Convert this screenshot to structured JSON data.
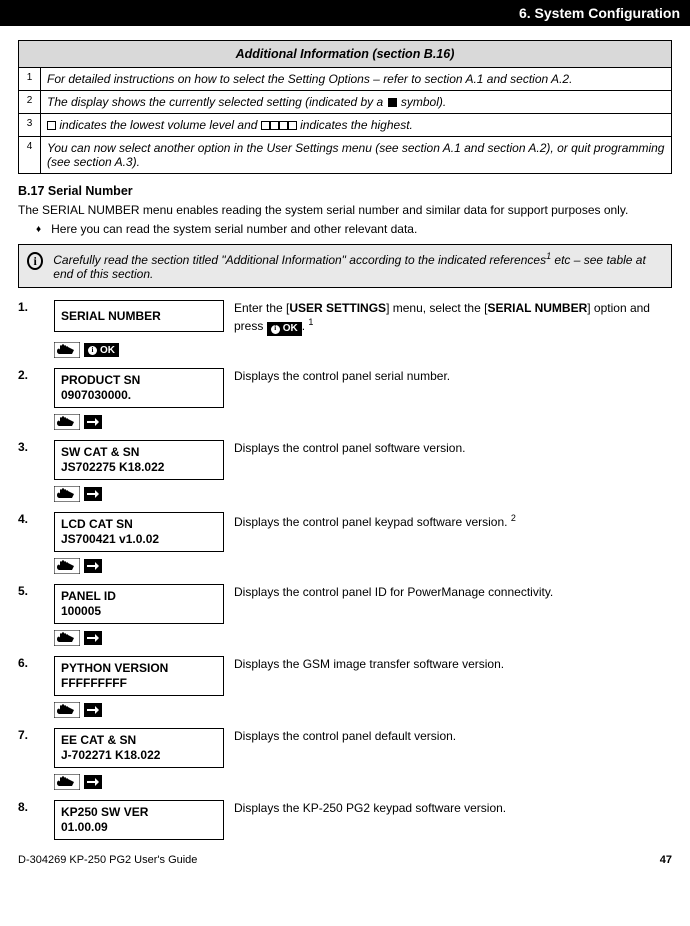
{
  "header": {
    "chapter": "6. System Configuration"
  },
  "ai_table": {
    "title": "Additional Information (section B.16)",
    "rows": [
      {
        "n": "1",
        "text": "For detailed instructions on how to select the Setting Options – refer to section A.1 and section A.2."
      },
      {
        "n": "2",
        "text_pre": "The display shows the currently selected setting (indicated by a ",
        "text_post": " symbol)."
      },
      {
        "n": "3",
        "text_pre_single": " indicates the lowest volume level and ",
        "text_post_single": " indicates the highest."
      },
      {
        "n": "4",
        "text": "You can now select another option in the User Settings menu (see section A.1 and section A.2), or quit programming (see section A.3)."
      }
    ]
  },
  "section": {
    "heading": "B.17 Serial Number",
    "intro": "The SERIAL NUMBER menu enables reading the system serial number and similar data for support purposes only.",
    "bullet": "Here you can read the system serial number and other relevant data."
  },
  "infobox": {
    "text_a": "Carefully read the section titled \"Additional Information\" according to the indicated references",
    "text_b": " etc – see table at end of this section."
  },
  "ok_label": "OK",
  "steps": [
    {
      "num": "1.",
      "display": [
        "SERIAL NUMBER"
      ],
      "desc_pre": "Enter the [",
      "desc_b1": "USER SETTINGS",
      "desc_mid": "] menu, select the [",
      "desc_b2": "SERIAL NUMBER",
      "desc_post": "] option and press ",
      "desc_tail": ".",
      "ref": "1",
      "cue": "ok"
    },
    {
      "num": "2.",
      "display": [
        "PRODUCT SN",
        "0907030000."
      ],
      "desc": "Displays the control panel serial number.",
      "cue": "next"
    },
    {
      "num": "3.",
      "display": [
        "SW CAT & SN",
        "JS702275 K18.022"
      ],
      "desc": "Displays the control panel software version.",
      "cue": "next"
    },
    {
      "num": "4.",
      "display": [
        "LCD CAT SN",
        "JS700421 v1.0.02"
      ],
      "desc_pre2": "Displays the control panel keypad software version. ",
      "ref2": "2",
      "cue": "next"
    },
    {
      "num": "5.",
      "display": [
        "PANEL ID",
        "100005"
      ],
      "desc": "Displays the control panel ID for PowerManage connectivity.",
      "cue": "next"
    },
    {
      "num": "6.",
      "display": [
        "PYTHON VERSION",
        "FFFFFFFFF"
      ],
      "desc": "Displays the GSM image transfer software version.",
      "cue": "next"
    },
    {
      "num": "7.",
      "display": [
        "EE CAT & SN",
        "J-702271 K18.022"
      ],
      "desc": "Displays the control panel default version.",
      "cue": "next"
    },
    {
      "num": "8.",
      "display": [
        "KP250 SW VER",
        "01.00.09"
      ],
      "desc": "Displays the KP-250 PG2 keypad software version.",
      "cue": ""
    }
  ],
  "footer": {
    "left": "D-304269 KP-250 PG2 User's Guide",
    "right": "47"
  }
}
